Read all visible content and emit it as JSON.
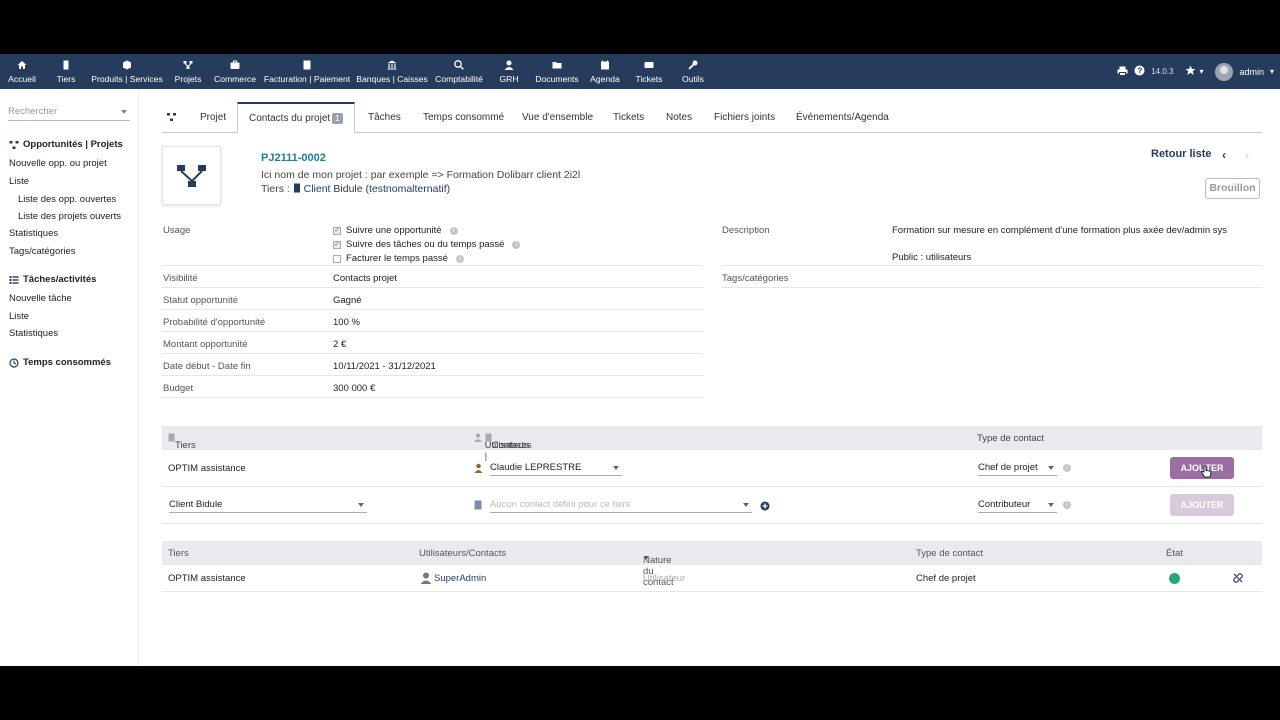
{
  "nav": {
    "items": [
      {
        "label": "Accueil",
        "icon": "home-icon"
      },
      {
        "label": "Tiers",
        "icon": "building-icon"
      },
      {
        "label": "Produits | Services",
        "icon": "cube-icon"
      },
      {
        "label": "Projets",
        "icon": "project-icon"
      },
      {
        "label": "Commerce",
        "icon": "briefcase-icon"
      },
      {
        "label": "Facturation | Paiement",
        "icon": "invoice-icon"
      },
      {
        "label": "Banques | Caisses",
        "icon": "bank-icon"
      },
      {
        "label": "Comptabilité",
        "icon": "search-dollar-icon"
      },
      {
        "label": "GRH",
        "icon": "user-icon"
      },
      {
        "label": "Documents",
        "icon": "folder-icon"
      },
      {
        "label": "Agenda",
        "icon": "calendar-icon"
      },
      {
        "label": "Tickets",
        "icon": "ticket-icon"
      },
      {
        "label": "Outils",
        "icon": "wrench-icon"
      }
    ],
    "version": "14.0.3",
    "user": "admin"
  },
  "left_menu": {
    "search_placeholder": "Rechercher",
    "section1_title": "Opportunités | Projets",
    "section1_items": [
      "Nouvelle opp. ou projet",
      "Liste",
      "Liste des opp. ouvertes",
      "Liste des projets ouverts",
      "Statistiques",
      "Tags/catégories"
    ],
    "section2_title": "Tâches/activités",
    "section2_items": [
      "Nouvelle tâche",
      "Liste",
      "Statistiques"
    ],
    "section3_title": "Temps consommés"
  },
  "tabs": [
    {
      "label": "Projet"
    },
    {
      "label": "Contacts du projet",
      "badge": "1"
    },
    {
      "label": "Tâches"
    },
    {
      "label": "Temps consommé"
    },
    {
      "label": "Vue d'ensemble"
    },
    {
      "label": "Tickets"
    },
    {
      "label": "Notes"
    },
    {
      "label": "Fichiers joints"
    },
    {
      "label": "Événements/Agenda"
    }
  ],
  "header": {
    "ref": "PJ2111-0002",
    "name": "Ici nom de mon projet : par exemple => Formation Dolibarr client 2i2l",
    "tiers_label": "Tiers : ",
    "tiers_value": "Client Bidule (testnomalternatif)",
    "back_to_list": "Retour liste",
    "status": "Brouillon"
  },
  "fields": {
    "usage_label": "Usage",
    "usage_opts": [
      {
        "label": "Suivre une opportunité",
        "checked": true
      },
      {
        "label": "Suivre des tâches ou du temps passé",
        "checked": true
      },
      {
        "label": "Facturer le temps passé",
        "checked": false
      }
    ],
    "visibility_label": "Visibilité",
    "visibility_value": "Contacts projet",
    "status_label": "Statut opportunité",
    "status_value": "Gagné",
    "prob_label": "Probabilité d'opportunité",
    "prob_value": "100 %",
    "amount_label": "Montant opportunité",
    "amount_value": "2 €",
    "dates_label": "Date début - Date fin",
    "dates_value": "10/11/2021 - 31/12/2021",
    "budget_label": "Budget",
    "budget_value": "300 000 €",
    "desc_label": "Description",
    "desc_line1": "Formation sur mesure en complément d'une formation plus axée dev/admin sys",
    "desc_line2": "Public : utilisateurs",
    "tags_label": "Tags/catégories"
  },
  "add_contacts": {
    "col_tiers": "Tiers",
    "col_users": "Utilisateurs | ",
    "col_contacts": "Contacts",
    "col_type": "Type de contact",
    "row1": {
      "tiers": "OPTIM assistance",
      "user": "Claudie LEPRESTRE",
      "type": "Chef de projet",
      "button": "AJOUTER"
    },
    "row2": {
      "tiers": "Client Bidule",
      "contact_placeholder": "Aucun contact défini pour ce tiers",
      "type": "Contributeur",
      "button": "AJOUTER"
    },
    "colors": {
      "button_active": "#9b6ea3",
      "button_disabled": "#d9c9dc"
    }
  },
  "contacts_list": {
    "col_tiers": "Tiers",
    "col_users": "Utilisateurs/Contacts",
    "col_nature": "Nature du contact",
    "col_type": "Type de contact",
    "col_state": "État",
    "rows": [
      {
        "tiers": "OPTIM assistance",
        "user": "SuperAdmin",
        "nature": "Utilisateur",
        "type": "Chef de projet",
        "state_color": "#25a580"
      }
    ]
  }
}
